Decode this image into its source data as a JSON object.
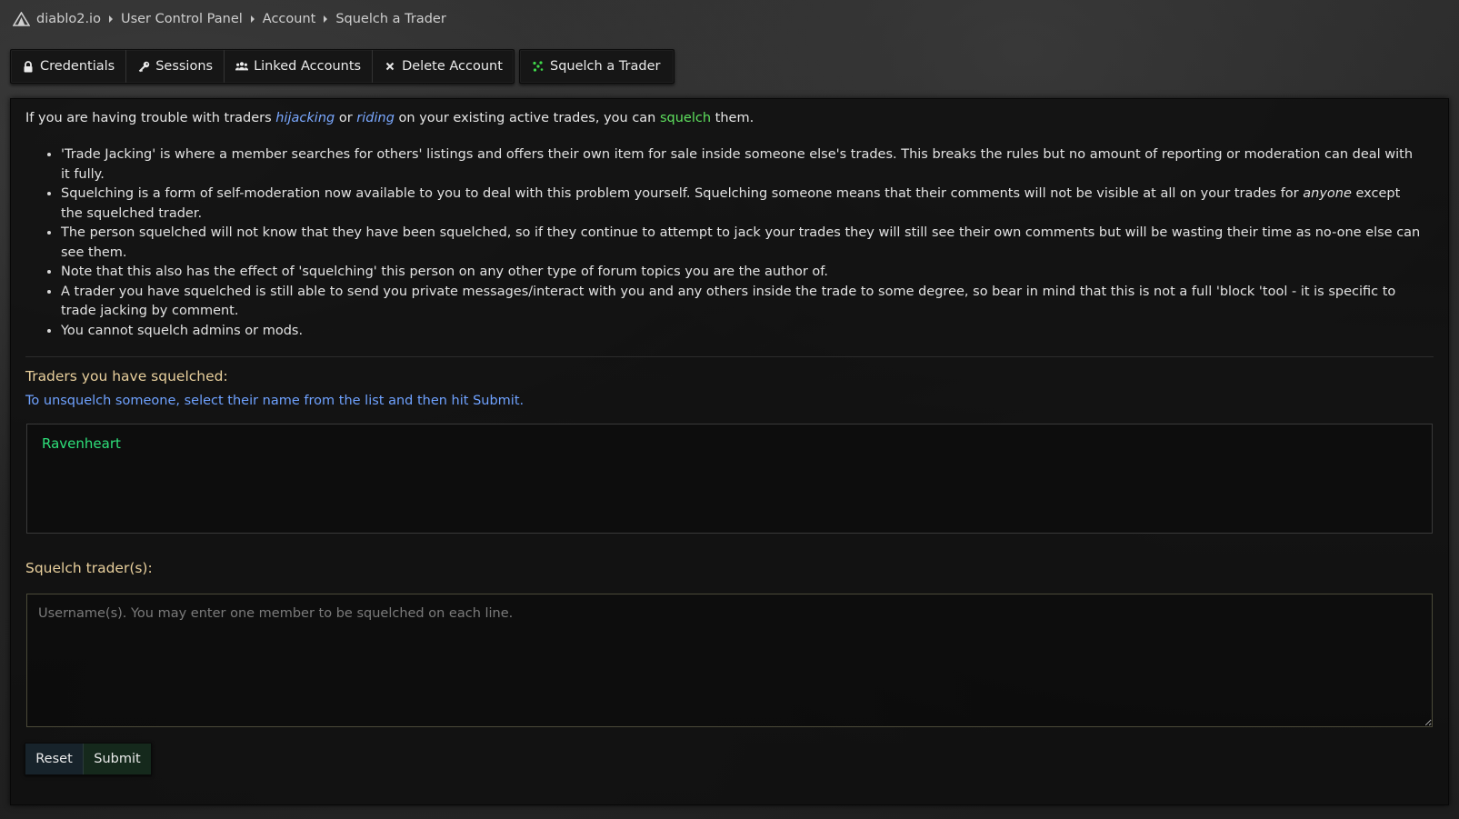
{
  "breadcrumb": {
    "items": [
      "diablo2.io",
      "User Control Panel",
      "Account",
      "Squelch a Trader"
    ]
  },
  "tabs": {
    "group1": [
      {
        "label": "Credentials",
        "icon": "lock-icon"
      },
      {
        "label": "Sessions",
        "icon": "key-icon"
      },
      {
        "label": "Linked Accounts",
        "icon": "users-icon"
      },
      {
        "label": "Delete Account",
        "icon": "x-icon"
      }
    ],
    "active": {
      "label": "Squelch a Trader",
      "icon": "squelch-icon"
    }
  },
  "intro": {
    "part1": "If you are having trouble with traders ",
    "hijacking": "hijacking",
    "or": " or ",
    "riding": "riding",
    "part2": " on your existing active trades, you can ",
    "squelch": "squelch",
    "part3": " them."
  },
  "rules": [
    {
      "text": "'Trade Jacking' is where a member searches for others' listings and offers their own item for sale inside someone else's trades. This breaks the rules but no amount of reporting or moderation can deal with it fully."
    },
    {
      "before": "Squelching is a form of self-moderation now available to you to deal with this problem yourself. Squelching someone means that their comments will not be visible at all on your trades for ",
      "italic": "anyone",
      "after": " except the squelched trader."
    },
    {
      "text": "The person squelched will not know that they have been squelched, so if they continue to attempt to jack your trades they will still see their own comments but will be wasting their time as no-one else can see them."
    },
    {
      "text": "Note that this also has the effect of 'squelching' this person on any other type of forum topics you are the author of."
    },
    {
      "text": "A trader you have squelched is still able to send you private messages/interact with you and any others inside the trade to some degree, so bear in mind that this is not a full 'block 'tool - it is specific to trade jacking by comment."
    },
    {
      "text": "You cannot squelch admins or mods."
    }
  ],
  "squelched": {
    "title": "Traders you have squelched:",
    "hint": "To unsquelch someone, select their name from the list and then hit Submit.",
    "list": [
      "Ravenheart"
    ]
  },
  "squelch_form": {
    "title": "Squelch trader(s):",
    "placeholder": "Username(s). You may enter one member to be squelched on each line.",
    "value": ""
  },
  "buttons": {
    "reset": "Reset",
    "submit": "Submit"
  },
  "colors": {
    "accent_blue": "#7aa8ff",
    "accent_green": "#5ee05e",
    "list_green": "#2ee07a",
    "section_gold": "#e8cf9c"
  }
}
